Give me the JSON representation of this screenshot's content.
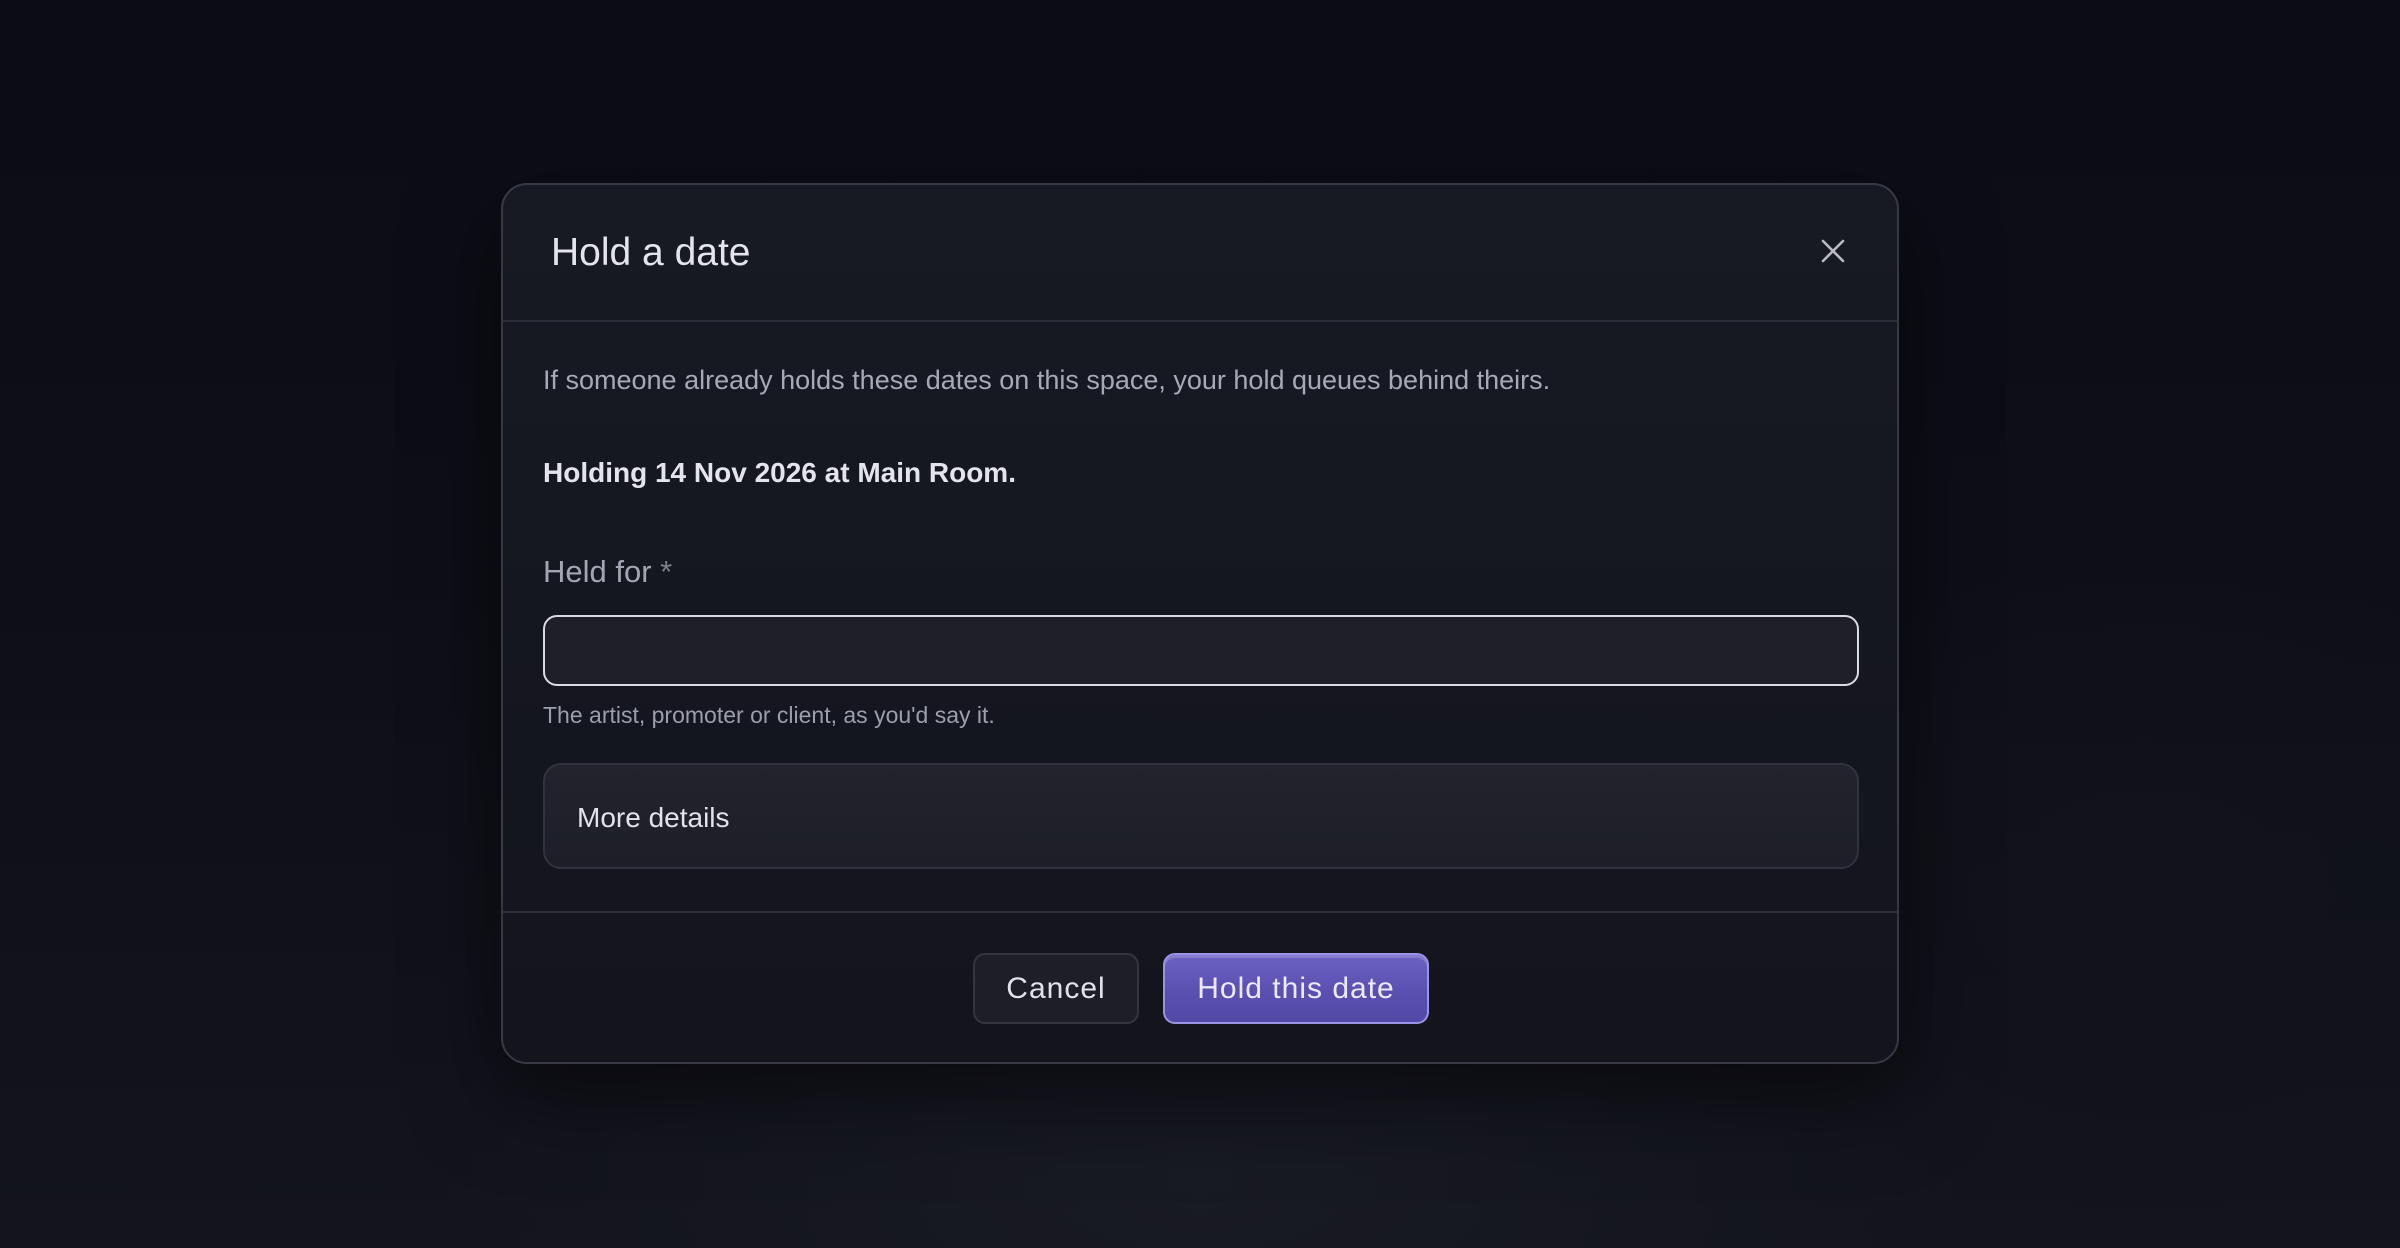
{
  "modal": {
    "title": "Hold a date",
    "close_icon": "close-icon",
    "intro": "If someone already holds these dates on this space, your hold queues behind theirs.",
    "holding_summary": "Holding 14 Nov 2026 at Main Room.",
    "field": {
      "label": "Held for",
      "required_marker": "*",
      "value": "",
      "placeholder": "",
      "helper": "The artist, promoter or client, as you'd say it."
    },
    "details_label": "More details",
    "buttons": {
      "cancel": "Cancel",
      "confirm": "Hold this date"
    }
  },
  "colors": {
    "background": "#0e0e17",
    "modal_surface": "#161821",
    "primary_accent": "#5e54b6",
    "text_primary": "#e4e5ec",
    "text_secondary": "#a7a9b6"
  }
}
